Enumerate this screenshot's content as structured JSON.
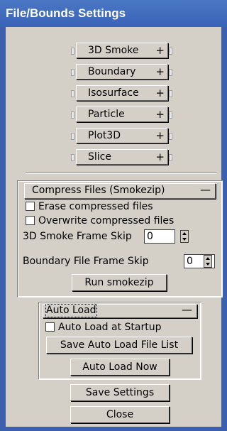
{
  "window": {
    "title": "File/Bounds Settings"
  },
  "rollouts": [
    {
      "label": "3D Smoke",
      "toggle": "+"
    },
    {
      "label": "Boundary",
      "toggle": "+"
    },
    {
      "label": "Isosurface",
      "toggle": "+"
    },
    {
      "label": "Particle",
      "toggle": "+"
    },
    {
      "label": "Plot3D",
      "toggle": "+"
    },
    {
      "label": "Slice",
      "toggle": "+"
    }
  ],
  "compress": {
    "header": "Compress Files (Smokezip)",
    "toggle": "—",
    "erase_label": "Erase compressed files",
    "overwrite_label": "Overwrite compressed files",
    "smoke_skip_label": "3D Smoke Frame Skip",
    "smoke_skip_value": "0",
    "boundary_skip_label": "Boundary File Frame Skip",
    "boundary_skip_value": "0",
    "run_button": "Run smokezip"
  },
  "autoload": {
    "header": "Auto Load",
    "toggle": "—",
    "startup_label": "Auto Load at Startup",
    "save_list_button": "Save Auto Load File List",
    "load_now_button": "Auto Load Now"
  },
  "footer": {
    "save_button": "Save Settings",
    "close_button": "Close"
  }
}
